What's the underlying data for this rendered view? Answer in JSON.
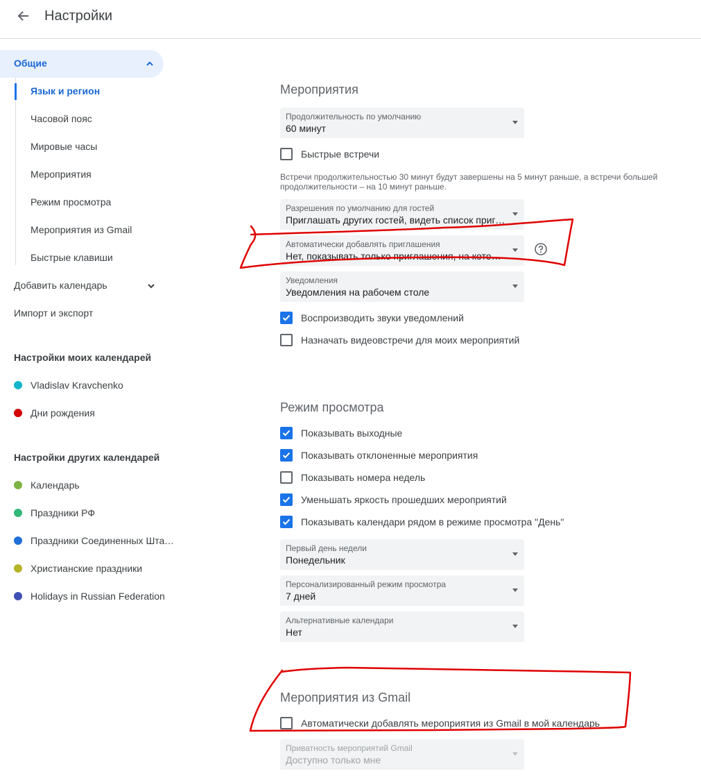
{
  "header": {
    "title": "Настройки"
  },
  "sidebar": {
    "general_label": "Общие",
    "sub_items": [
      {
        "label": "Язык и регион"
      },
      {
        "label": "Часовой пояс"
      },
      {
        "label": "Мировые часы"
      },
      {
        "label": "Мероприятия"
      },
      {
        "label": "Режим просмотра"
      },
      {
        "label": "Мероприятия из Gmail"
      },
      {
        "label": "Быстрые клавиши"
      }
    ],
    "add_calendar": "Добавить календарь",
    "import_export": "Импорт и экспорт",
    "my_calendars_title": "Настройки моих календарей",
    "my_calendars": [
      {
        "name": "Vladislav Kravchenko",
        "color": "#12b5cb"
      },
      {
        "name": "Дни рождения",
        "color": "#d50000"
      }
    ],
    "other_calendars_title": "Настройки других календарей",
    "other_calendars": [
      {
        "name": "Календарь",
        "color": "#7cb342"
      },
      {
        "name": "Праздники РФ",
        "color": "#33b679"
      },
      {
        "name": "Праздники Соединенных Штатов",
        "color": "#1e6fd9"
      },
      {
        "name": "Христианские праздники",
        "color": "#b6b427"
      },
      {
        "name": "Holidays in Russian Federation",
        "color": "#3f51b5"
      }
    ]
  },
  "events": {
    "title": "Мероприятия",
    "duration": {
      "label": "Продолжительность по умолчанию",
      "value": "60 минут"
    },
    "speedy_meetings": {
      "label": "Быстрые встречи",
      "checked": false
    },
    "hint": "Встречи продолжительностью 30 минут будут завершены на 5 минут раньше, а встречи большей продолжительности – на 10 минут раньше.",
    "guest_permissions": {
      "label": "Разрешения по умолчанию для гостей",
      "value": "Приглашать других гостей, видеть список приглашенных"
    },
    "auto_add_invites": {
      "label": "Автоматически добавлять приглашения",
      "value": "Нет, показывать только приглашения, на которые я ответил"
    },
    "notifications": {
      "label": "Уведомления",
      "value": "Уведомления на рабочем столе"
    },
    "play_sounds": {
      "label": "Воспроизводить звуки уведомлений",
      "checked": true
    },
    "video_meetings": {
      "label": "Назначать видеовстречи для моих мероприятий",
      "checked": false
    }
  },
  "view": {
    "title": "Режим просмотра",
    "options": [
      {
        "label": "Показывать выходные",
        "checked": true
      },
      {
        "label": "Показывать отклоненные мероприятия",
        "checked": true
      },
      {
        "label": "Показывать номера недель",
        "checked": false
      },
      {
        "label": "Уменьшать яркость прошедших мероприятий",
        "checked": true
      },
      {
        "label": "Показывать календари рядом в режиме просмотра \"День\"",
        "checked": true
      }
    ],
    "first_day": {
      "label": "Первый день недели",
      "value": "Понедельник"
    },
    "custom_view": {
      "label": "Персонализированный режим просмотра",
      "value": "7 дней"
    },
    "alt_calendars": {
      "label": "Альтернативные календари",
      "value": "Нет"
    }
  },
  "gmail": {
    "title": "Мероприятия из Gmail",
    "auto_add": {
      "label": "Автоматически добавлять мероприятия из Gmail в мой календарь",
      "checked": false
    },
    "privacy": {
      "label": "Приватность мероприятий Gmail",
      "value": "Доступно только мне"
    }
  },
  "colors": {
    "accent": "#1a73e8",
    "active_nav_bg": "#e8f0fe",
    "annotation": "#e00000"
  }
}
